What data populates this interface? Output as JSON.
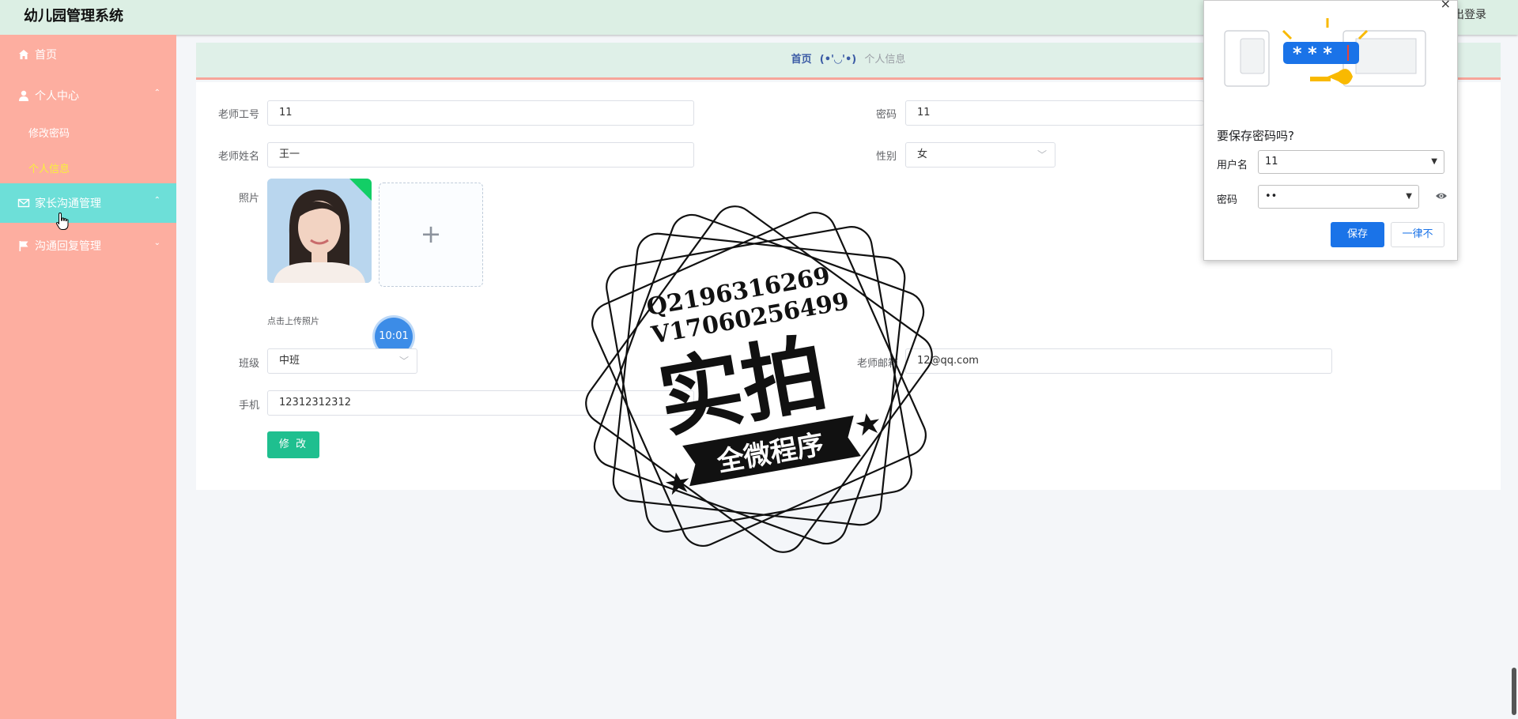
{
  "app": {
    "title": "幼儿园管理系统",
    "logout": "退出登录"
  },
  "sidebar": {
    "items": [
      {
        "label": "首页",
        "icon": "home-icon"
      },
      {
        "label": "个人中心",
        "icon": "user-icon"
      },
      {
        "label": "家长沟通管理",
        "icon": "mail-icon"
      },
      {
        "label": "沟通回复管理",
        "icon": "flag-icon"
      }
    ],
    "sub_items": [
      {
        "label": "修改密码"
      },
      {
        "label": "个人信息"
      }
    ]
  },
  "breadcrumb": {
    "home": "首页",
    "face": "(•'◡'•)",
    "current": "个人信息"
  },
  "form": {
    "teacher_id_label": "老师工号",
    "teacher_id_value": "11",
    "password_label": "密码",
    "password_value": "11",
    "teacher_name_label": "老师姓名",
    "teacher_name_value": "王一",
    "gender_label": "性别",
    "gender_value": "女",
    "photo_label": "照片",
    "upload_plus": "+",
    "upload_tip": "点击上传照片",
    "class_label": "班级",
    "class_value": "中班",
    "email_label": "老师邮箱",
    "email_value": "12@qq.com",
    "phone_label": "手机",
    "phone_value": "12312312312",
    "submit_label": "修 改"
  },
  "clock": {
    "time": "10:01"
  },
  "watermark": {
    "line1": "Q2196316269",
    "line2": "V17060256499",
    "main": "实拍",
    "banner": "全微程序"
  },
  "password_popup": {
    "close": "×",
    "stars": "* * *",
    "title": "要保存密码吗?",
    "username_label": "用户名",
    "username_value": "11",
    "password_label": "密码",
    "password_value": "••",
    "save_label": "保存",
    "never_label": "一律不"
  },
  "colors": {
    "sidebar": "#fdaea0",
    "sidebar_active": "#6ddfd8",
    "header": "#dcefe4",
    "accent_green": "#1fbf8f",
    "popup_blue": "#1a73e8",
    "current_sub": "#f8f03c"
  }
}
